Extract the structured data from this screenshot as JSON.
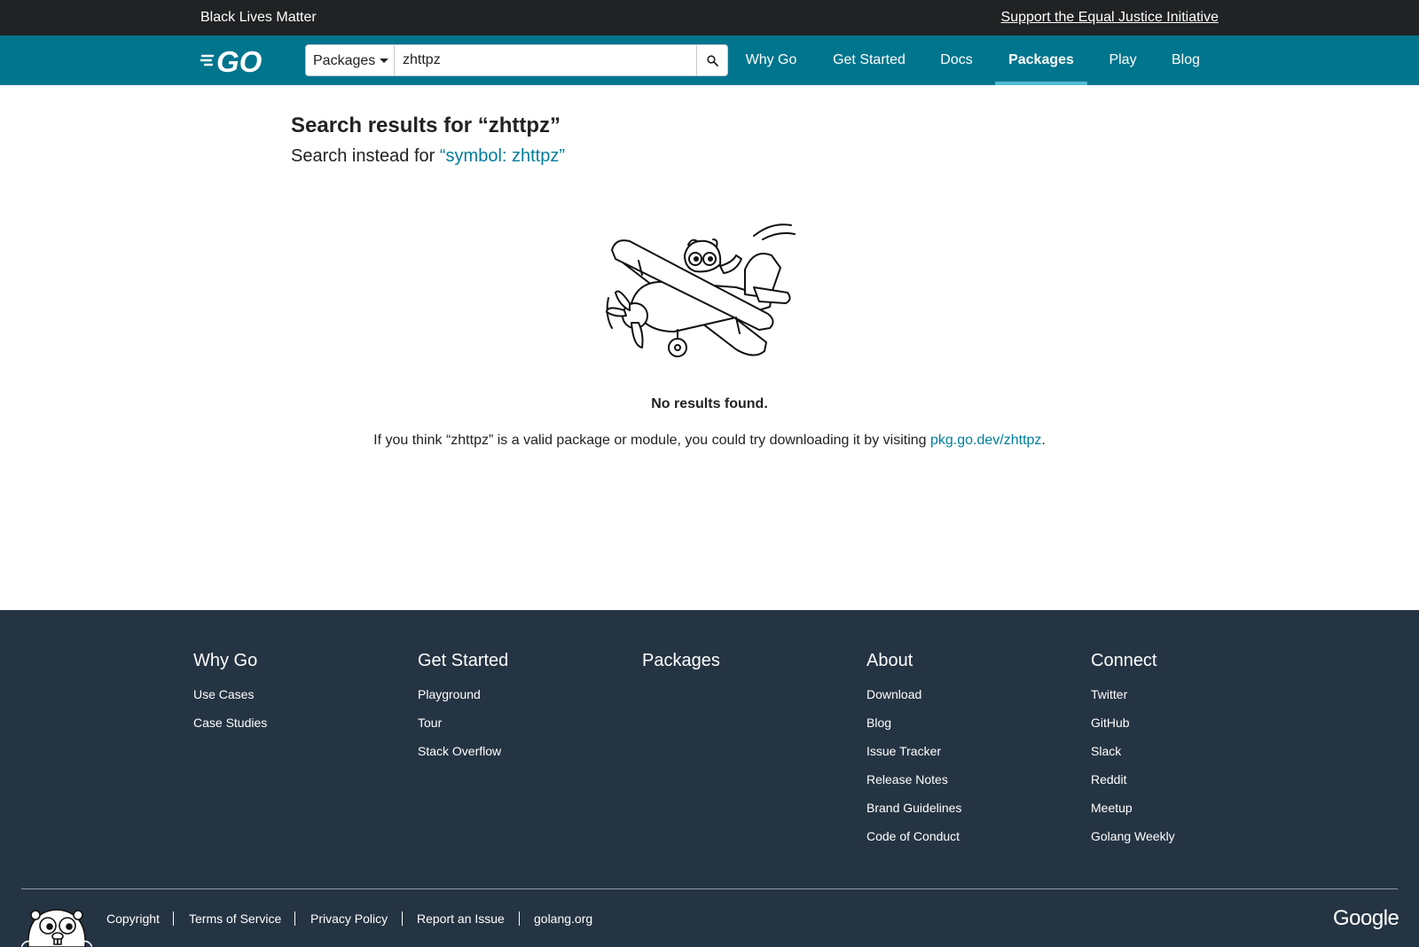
{
  "banner": {
    "left_text": "Black Lives Matter",
    "right_link": "Support the Equal Justice Initiative"
  },
  "header": {
    "logo_alt": "GO",
    "search": {
      "mode": "Packages",
      "query": "zhttpz",
      "button_icon": "search-icon"
    },
    "nav": [
      {
        "label": "Why Go",
        "active": false
      },
      {
        "label": "Get Started",
        "active": false
      },
      {
        "label": "Docs",
        "active": false
      },
      {
        "label": "Packages",
        "active": true
      },
      {
        "label": "Play",
        "active": false
      },
      {
        "label": "Blog",
        "active": false
      }
    ]
  },
  "main": {
    "title": "Search results for “zhttpz”",
    "instead_prefix": "Search instead for ",
    "instead_link": "“symbol: zhttpz”",
    "illustration": "gopher-airplane-icon",
    "no_results": "No results found.",
    "hint_prefix": "If you think “zhttpz” is a valid package or module, you could try downloading it by visiting ",
    "hint_link": "pkg.go.dev/zhttpz",
    "hint_suffix": "."
  },
  "footer": {
    "columns": [
      {
        "heading": "Why Go",
        "links": [
          "Use Cases",
          "Case Studies"
        ]
      },
      {
        "heading": "Get Started",
        "links": [
          "Playground",
          "Tour",
          "Stack Overflow"
        ]
      },
      {
        "heading": "Packages",
        "links": []
      },
      {
        "heading": "About",
        "links": [
          "Download",
          "Blog",
          "Issue Tracker",
          "Release Notes",
          "Brand Guidelines",
          "Code of Conduct"
        ]
      },
      {
        "heading": "Connect",
        "links": [
          "Twitter",
          "GitHub",
          "Slack",
          "Reddit",
          "Meetup",
          "Golang Weekly"
        ]
      }
    ],
    "bottom_links": [
      "Copyright",
      "Terms of Service",
      "Privacy Policy",
      "Report an Issue",
      "golang.org"
    ],
    "brand": "Google",
    "mascot": "gopher-icon"
  },
  "colors": {
    "banner_bg": "#202224",
    "header_bg": "#00758d",
    "link": "#007d9c",
    "footer_bg": "#253443",
    "active_underline": "#5dc9e2"
  }
}
